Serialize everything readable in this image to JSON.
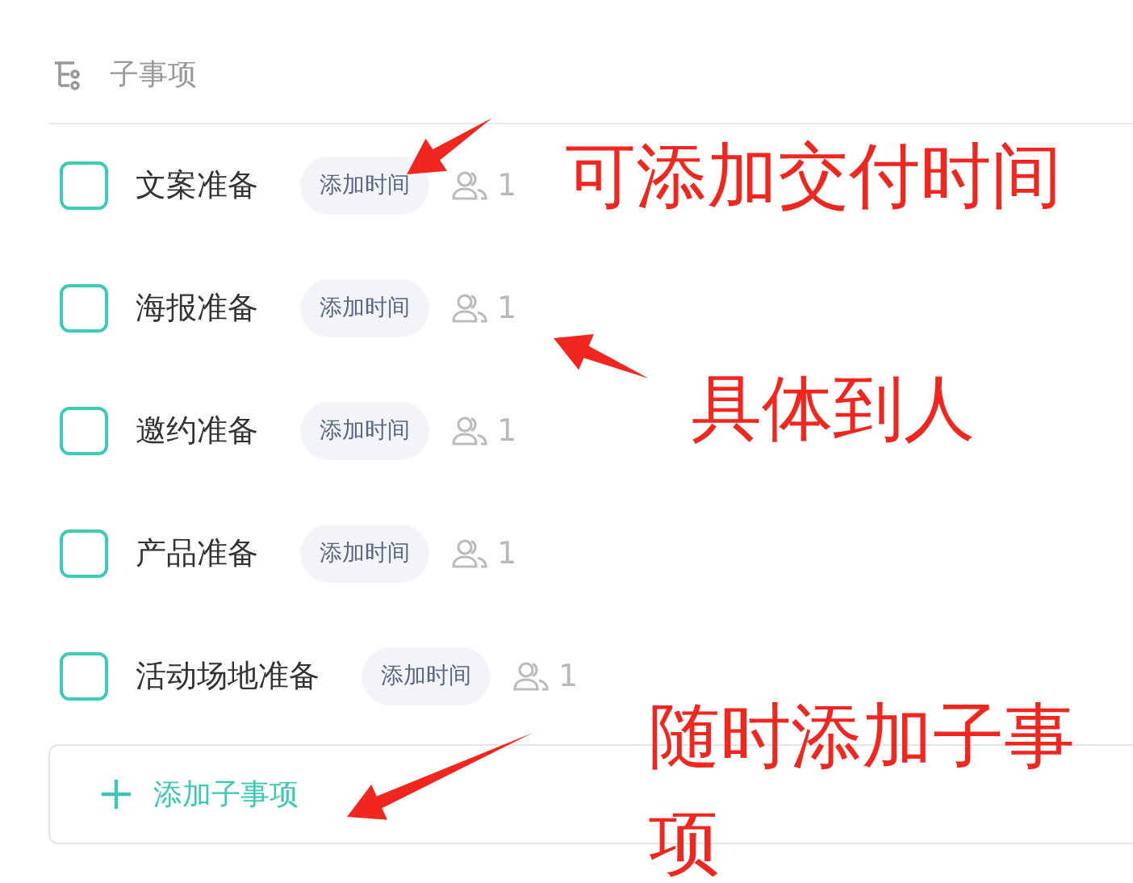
{
  "section": {
    "title": "子事项"
  },
  "subtasks": [
    {
      "title": "文案准备",
      "checked": false,
      "time_button": "添加时间",
      "assignee_count": "1"
    },
    {
      "title": "海报准备",
      "checked": false,
      "time_button": "添加时间",
      "assignee_count": "1"
    },
    {
      "title": "邀约准备",
      "checked": false,
      "time_button": "添加时间",
      "assignee_count": "1"
    },
    {
      "title": "产品准备",
      "checked": false,
      "time_button": "添加时间",
      "assignee_count": "1"
    },
    {
      "title": "活动场地准备",
      "checked": false,
      "time_button": "添加时间",
      "assignee_count": "1"
    }
  ],
  "add_button": {
    "label": "添加子事项"
  },
  "annotations": [
    {
      "text": "可添加交付时间"
    },
    {
      "text": "具体到人"
    },
    {
      "text": "随时添加子事项"
    }
  ]
}
